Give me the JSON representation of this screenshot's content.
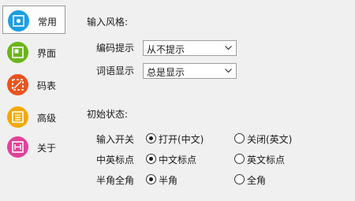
{
  "sidebar": {
    "items": [
      {
        "label": "常用",
        "icon": "general-settings-icon",
        "color": "#1b9ee0",
        "active": true
      },
      {
        "label": "界面",
        "icon": "interface-icon",
        "color": "#6ab51b",
        "active": false
      },
      {
        "label": "码表",
        "icon": "code-table-icon",
        "color": "#e8541e",
        "active": false
      },
      {
        "label": "高级",
        "icon": "advanced-icon",
        "color": "#f2a900",
        "active": false
      },
      {
        "label": "关于",
        "icon": "about-icon",
        "color": "#e0429a",
        "active": false
      }
    ]
  },
  "input_style": {
    "title": "输入风格:",
    "encoding_hint": {
      "label": "编码提示",
      "value": "从不提示"
    },
    "phrase_display": {
      "label": "词语显示",
      "value": "总是显示"
    }
  },
  "initial_state": {
    "title": "初始状态:",
    "rows": [
      {
        "label": "输入开关",
        "options": [
          "打开(中文)",
          "关闭(英文)"
        ],
        "selected": 0
      },
      {
        "label": "中英标点",
        "options": [
          "中文标点",
          "英文标点"
        ],
        "selected": 0
      },
      {
        "label": "半角全角",
        "options": [
          "半角",
          "全角"
        ],
        "selected": 0
      }
    ]
  }
}
